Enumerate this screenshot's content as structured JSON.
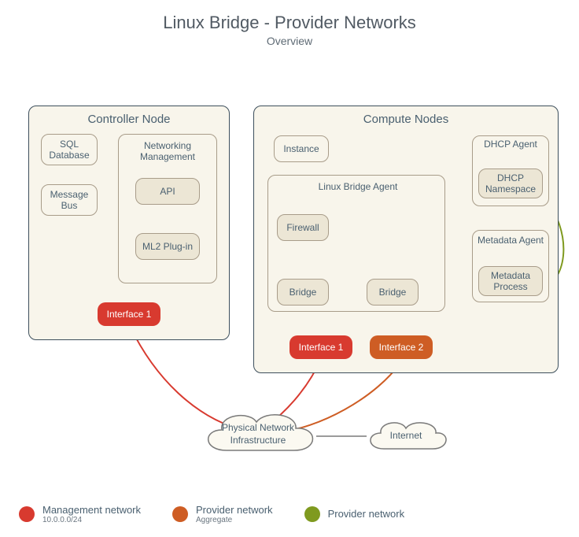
{
  "title": "Linux Bridge - Provider Networks",
  "subtitle": "Overview",
  "controller": {
    "title": "Controller Node",
    "sql": "SQL Database",
    "msgbus": "Message Bus",
    "netmgmt": "Networking Management",
    "api": "API",
    "ml2": "ML2 Plug-in",
    "iface1": "Interface 1"
  },
  "compute": {
    "title": "Compute Nodes",
    "instance": "Instance",
    "lba": "Linux Bridge Agent",
    "firewall": "Firewall",
    "bridge1": "Bridge",
    "bridge2": "Bridge",
    "dhcp_agent": "DHCP Agent",
    "dhcp_ns": "DHCP Namespace",
    "meta_agent": "Metadata Agent",
    "meta_proc": "Metadata Process",
    "iface1": "Interface 1",
    "iface2": "Interface 2"
  },
  "cloud": {
    "phys": "Physical Network Infrastructure",
    "internet": "Internet"
  },
  "legend": {
    "mgmt": "Management network",
    "mgmt_sub": "10.0.0.0/24",
    "prov1": "Provider network",
    "prov1_sub": "Aggregate",
    "prov2": "Provider network"
  },
  "colors": {
    "red": "#d83a2f",
    "orange": "#ce5d24",
    "green": "#7f9a1f",
    "gray": "#7a7a7a"
  }
}
